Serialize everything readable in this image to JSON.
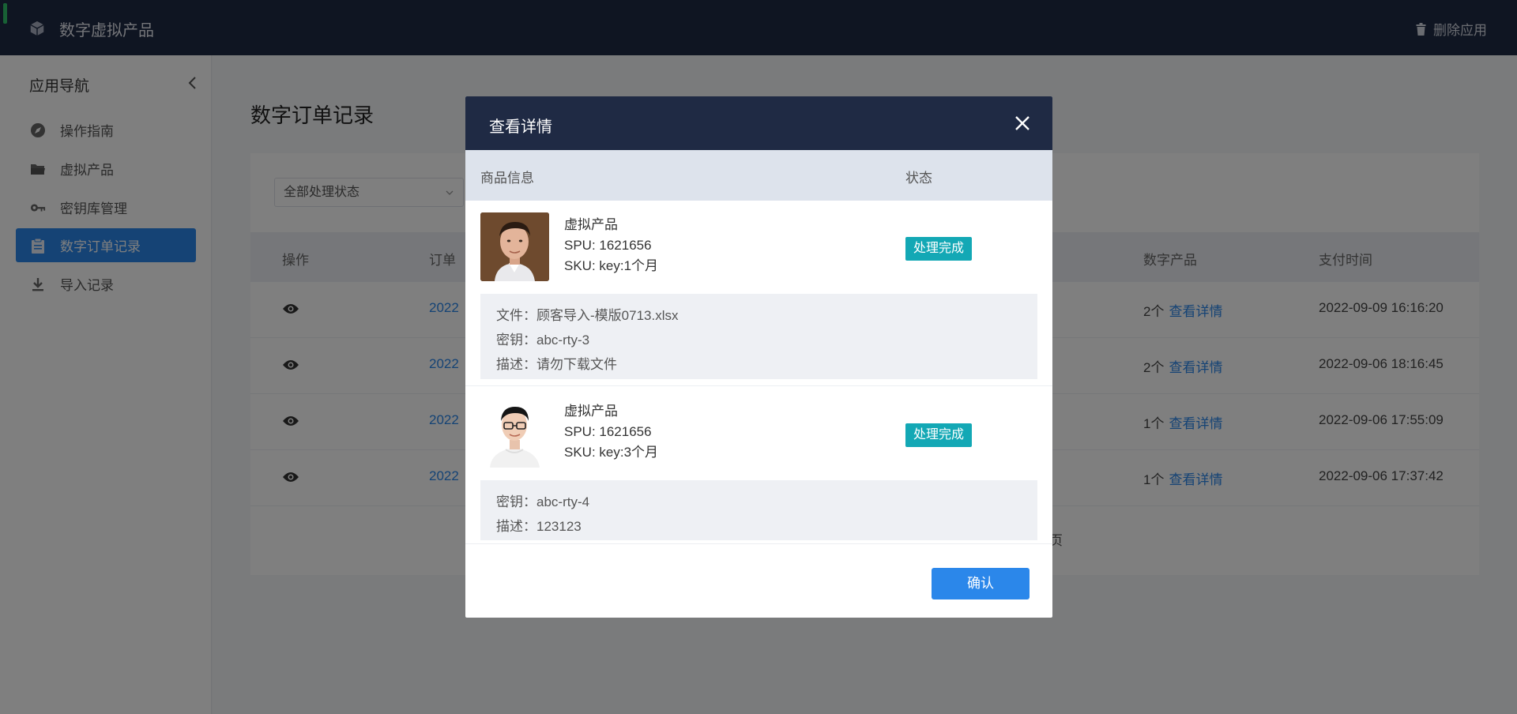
{
  "app": {
    "title": "数字虚拟产品",
    "delete_label": "删除应用"
  },
  "sidebar": {
    "heading": "应用导航",
    "items": [
      {
        "label": "操作指南",
        "icon": "compass-icon"
      },
      {
        "label": "虚拟产品",
        "icon": "folder-icon"
      },
      {
        "label": "密钥库管理",
        "icon": "key-icon"
      },
      {
        "label": "数字订单记录",
        "icon": "clipboard-icon",
        "active": true
      },
      {
        "label": "导入记录",
        "icon": "download-icon"
      }
    ]
  },
  "main": {
    "title": "数字订单记录",
    "filter": {
      "value": "全部处理状态"
    },
    "columns": {
      "action": "操作",
      "order": "订单",
      "digital": "数字产品",
      "pay_time": "支付时间"
    },
    "rows": [
      {
        "order": "2022",
        "count": "2个",
        "link": "查看详情",
        "pay_time": "2022-09-09 16:16:20"
      },
      {
        "order": "2022",
        "count": "2个",
        "link": "查看详情",
        "pay_time": "2022-09-06 18:16:45"
      },
      {
        "order": "2022",
        "count": "1个",
        "link": "查看详情",
        "pay_time": "2022-09-06 17:55:09"
      },
      {
        "order": "2022",
        "count": "1个",
        "link": "查看详情",
        "pay_time": "2022-09-06 17:37:42"
      }
    ],
    "pager_tail": "页"
  },
  "modal": {
    "title": "查看详情",
    "columns": {
      "product": "商品信息",
      "status": "状态"
    },
    "items": [
      {
        "name": "虚拟产品",
        "spu": "SPU: 1621656",
        "sku": "SKU: key:1个月",
        "status": "处理完成",
        "file": "文件：顾客导入-模版0713.xlsx",
        "key": "密钥：abc-rty-3",
        "desc": "描述：请勿下载文件"
      },
      {
        "name": "虚拟产品",
        "spu": "SPU: 1621656",
        "sku": "SKU: key:3个月",
        "status": "处理完成",
        "key": "密钥：abc-rty-4",
        "desc": "描述：123123"
      }
    ],
    "confirm_label": "确认"
  },
  "colors": {
    "header_bg": "#1f2a44",
    "accent": "#2b87ea",
    "status_tag": "#13a8b5"
  }
}
